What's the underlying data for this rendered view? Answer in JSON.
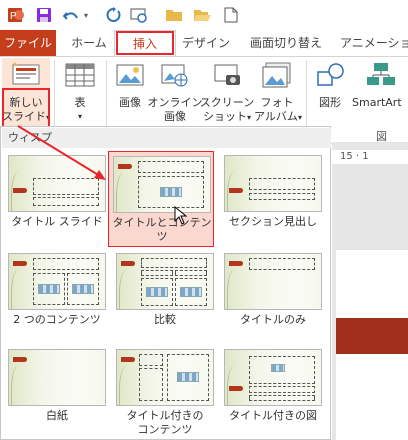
{
  "colors": {
    "brand": "#c43e1c",
    "highlight": "#e8262b",
    "selection_fill": "#fbd8cf",
    "slide_accent": "#b3351d"
  },
  "qat": {
    "icons": [
      "powerpoint-icon",
      "save-icon",
      "undo-icon",
      "undo-dropdown-icon",
      "redo-icon",
      "presenter-view-icon",
      "folder-icon",
      "open-folder-icon",
      "new-document-icon"
    ]
  },
  "tabs": [
    {
      "label": "ファイル",
      "kind": "file"
    },
    {
      "label": "ホーム"
    },
    {
      "label": "挿入",
      "active": true
    },
    {
      "label": "デザイン"
    },
    {
      "label": "画面切り替え"
    },
    {
      "label": "アニメーション"
    }
  ],
  "ribbon": {
    "new_slide_line1": "新しい",
    "new_slide_line2": "スライド",
    "table": "表",
    "image": "画像",
    "online_image_line1": "オンライン",
    "online_image_line2": "画像",
    "screenshot_line1": "スクリーン",
    "screenshot_line2": "ショット",
    "photo_album_line1": "フォト",
    "photo_album_line2": "アルバム",
    "shapes": "図形",
    "smartart": "SmartArt",
    "group_diagram": "図",
    "ruler_text": "15 · 1"
  },
  "gallery": {
    "theme_name": "ウィスプ",
    "layouts": [
      {
        "label": "タイトル スライド"
      },
      {
        "label": "タイトルとコンテンツ",
        "selected": true
      },
      {
        "label": "セクション見出し"
      },
      {
        "label": "2 つのコンテンツ"
      },
      {
        "label": "比較"
      },
      {
        "label": "タイトルのみ"
      },
      {
        "label": "白紙"
      },
      {
        "label": "タイトル付きの\nコンテンツ"
      },
      {
        "label": "タイトル付きの図"
      }
    ]
  }
}
